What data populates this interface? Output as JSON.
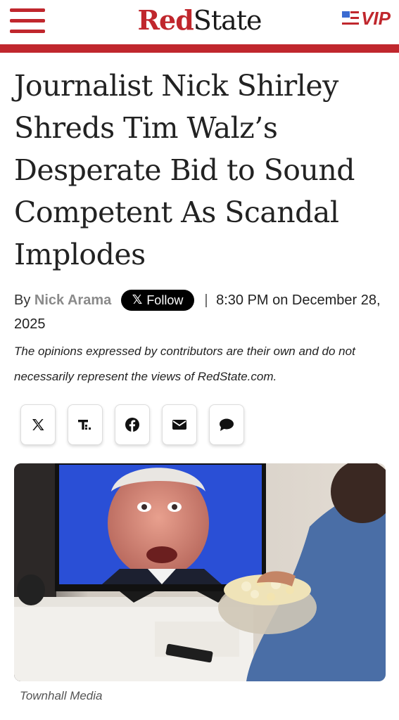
{
  "header": {
    "logo_red": "Red",
    "logo_dark": "State",
    "vip_label": "VIP",
    "accent_color": "#c0272d"
  },
  "article": {
    "headline": "Journalist Nick Shirley Shreds Tim Walz’s Desperate Bid to Sound Competent As Scandal Implodes",
    "by": "By",
    "author": "Nick Arama",
    "follow_label": "Follow",
    "separator": "|",
    "date": "8:30 PM on December 28, 2025",
    "disclaimer": "The opinions expressed by contributors are their own and do not necessarily represent the views of RedState.com.",
    "share_icons": [
      "x-icon",
      "townhall-icon",
      "facebook-icon",
      "email-icon",
      "comment-icon"
    ],
    "image_caption": "Townhall Media"
  }
}
